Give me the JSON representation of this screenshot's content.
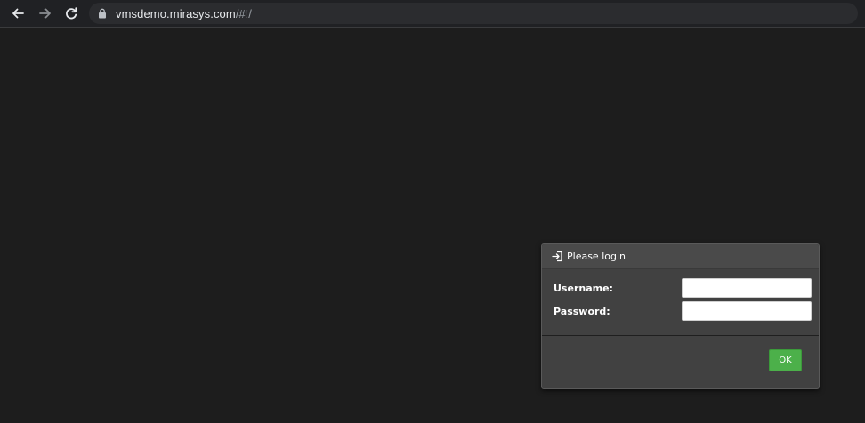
{
  "browser": {
    "url_host": "vmsdemo.mirasys.com",
    "url_path": "/#!/",
    "icons": {
      "back": "arrow-left-icon",
      "forward": "arrow-right-icon",
      "reload": "reload-icon",
      "lock": "lock-icon"
    }
  },
  "login": {
    "title": "Please login",
    "icon": "login-icon",
    "username_label": "Username:",
    "password_label": "Password:",
    "username_value": "",
    "password_value": "",
    "ok_label": "OK"
  },
  "colors": {
    "page_background": "#1d1d1d",
    "panel_background": "#414141",
    "ok_button": "#4cb04a"
  }
}
